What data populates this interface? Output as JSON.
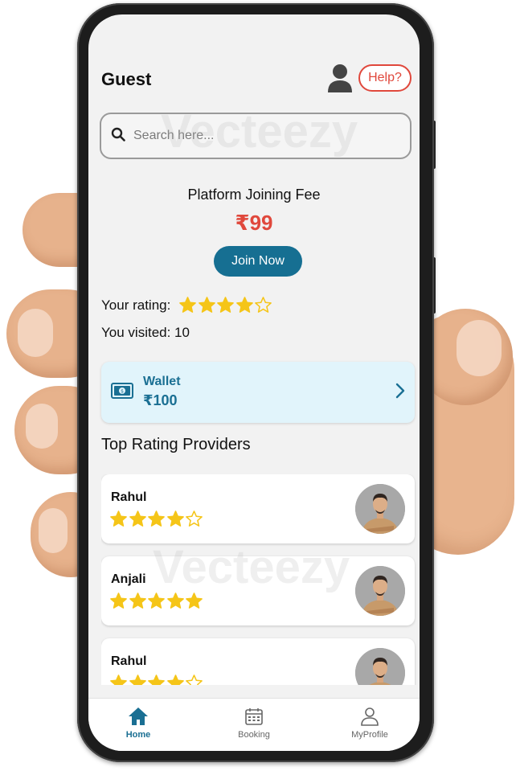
{
  "header": {
    "title": "Guest",
    "help_label": "Help?"
  },
  "search": {
    "placeholder": "Search here..."
  },
  "fee": {
    "label": "Platform Joining Fee",
    "price": "₹99",
    "join_label": "Join Now"
  },
  "user_stats": {
    "rating_label": "Your rating:",
    "rating": 4,
    "max_rating": 5,
    "visited_label": "You visited: 10"
  },
  "wallet": {
    "label": "Wallet",
    "amount": "₹100"
  },
  "providers": {
    "title": "Top Rating Providers",
    "items": [
      {
        "name": "Rahul",
        "rating": 4
      },
      {
        "name": "Anjali",
        "rating": 5
      },
      {
        "name": "Rahul",
        "rating": 4
      }
    ]
  },
  "nav": {
    "items": [
      {
        "label": "Home"
      },
      {
        "label": "Booking"
      },
      {
        "label": "MyProfile"
      }
    ]
  },
  "watermark": "Vecteezy",
  "colors": {
    "accent": "#166f92",
    "price": "#e0483c",
    "star": "#f5c518",
    "wallet_bg": "#e1f4fb"
  },
  "icons": [
    "search-icon",
    "user-icon",
    "money-icon",
    "chevron-right-icon",
    "home-icon",
    "calendar-icon",
    "profile-icon",
    "star-icon"
  ]
}
